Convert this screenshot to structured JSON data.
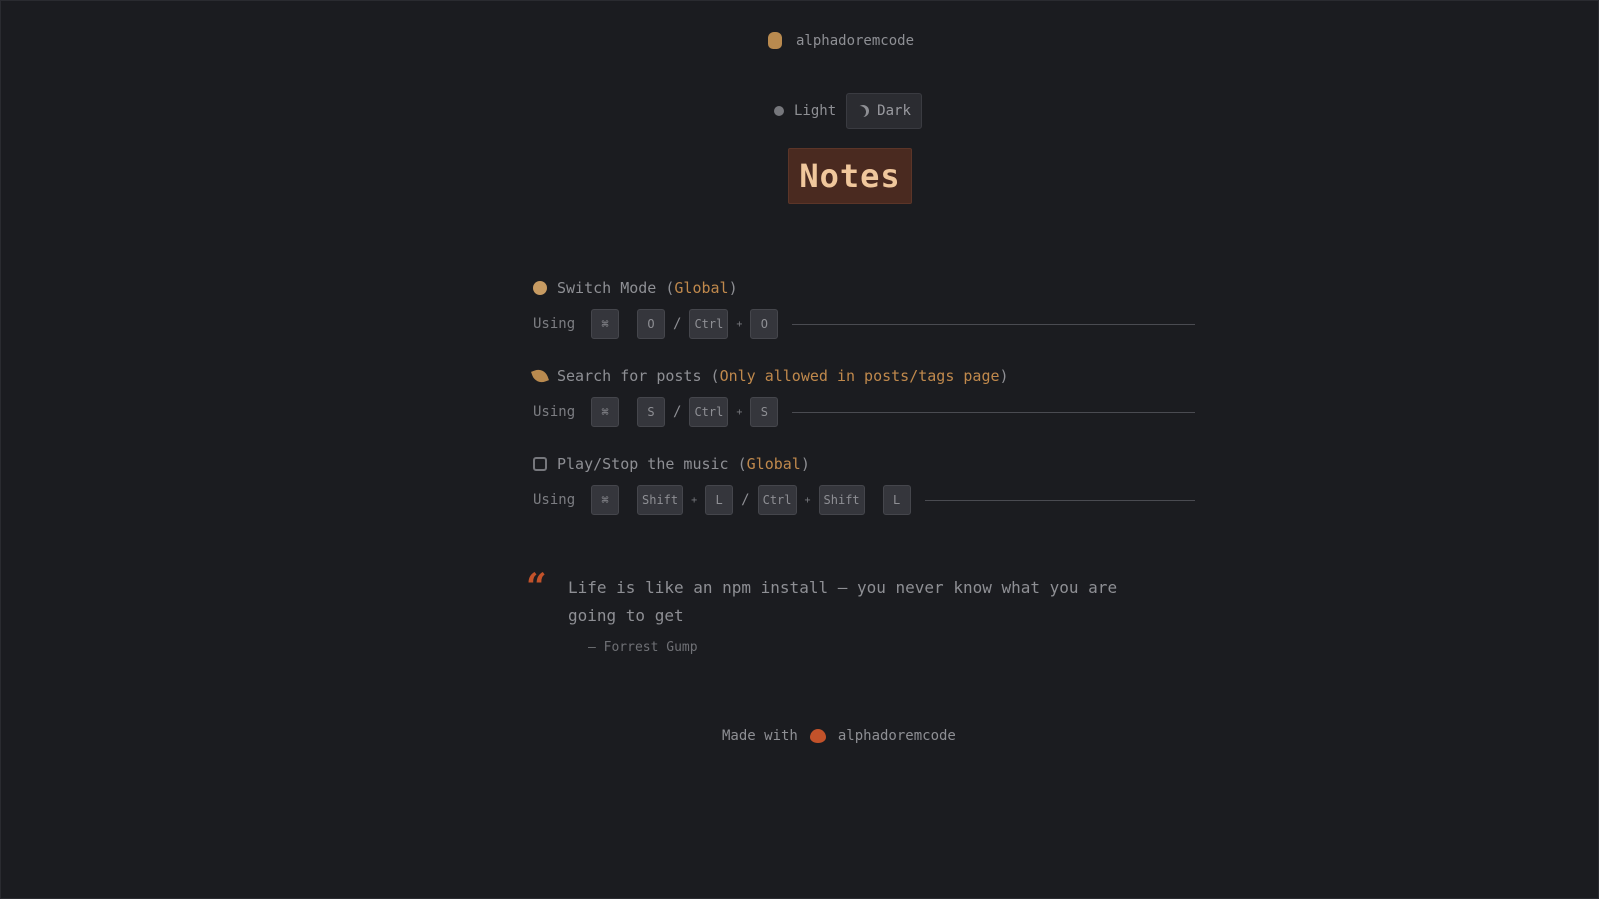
{
  "header": {
    "brand": "alphadoremcode"
  },
  "theme": {
    "light_label": "Light",
    "dark_label": "Dark"
  },
  "page_title": "Notes",
  "shortcuts": [
    {
      "label": "Switch Mode (",
      "scope": "Global",
      "close": ")",
      "using": "Using",
      "keys": [
        "⌘",
        "O",
        "Ctrl",
        "O"
      ]
    },
    {
      "label": "Search for posts (",
      "scope": "Only allowed in posts/tags page",
      "close": ")",
      "using": "Using",
      "keys": [
        "⌘",
        "S",
        "Ctrl",
        "S"
      ]
    },
    {
      "label": "Play/Stop the music (",
      "scope": "Global",
      "close": ")",
      "using": "Using",
      "keys": [
        "⌘",
        "Shift",
        "L",
        "Ctrl",
        "Shift",
        "L"
      ]
    }
  ],
  "quote": {
    "text": "Life is like an npm install — you never know what you are going to get",
    "author": "— Forrest Gump"
  },
  "footer": {
    "made_with": "Made with",
    "author": "alphadoremcode"
  },
  "colors": {
    "accent": "#c0894c",
    "title_bg": "#4a2a20",
    "title_text": "#f0c79c",
    "heart": "#c2522a",
    "background": "#1b1c20"
  }
}
